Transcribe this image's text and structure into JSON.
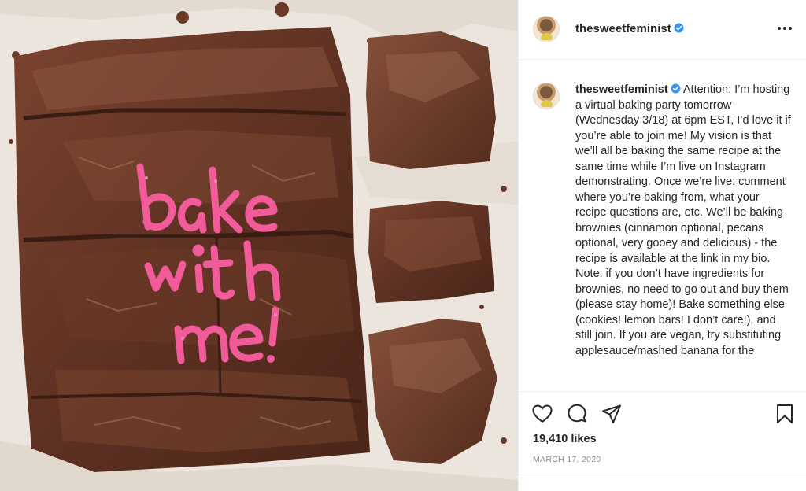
{
  "post": {
    "image_alt_text": "bake with me!",
    "username": "thesweetfeminist",
    "verified": true,
    "caption": "Attention: I’m hosting a virtual baking party tomorrow (Wednesday 3/18) at 6pm EST, I’d love it if you’re able to join me! My vision is that we’ll all be baking the same recipe at the same time while I’m live on Instagram demonstrating. Once we’re live: comment where you’re baking from, what your recipe questions are, etc. We’ll be baking brownies (cinnamon optional, pecans optional, very gooey and delicious) - the recipe is available at the link in my bio. Note: if you don’t have ingredients for brownies, no need to go out and buy them (please stay home)! Bake something else (cookies! lemon bars! I don’t care!), and still join. If you are vegan, try substituting applesauce/mashed banana for the",
    "likes": "19,410 likes",
    "date": "MARCH 17, 2020"
  },
  "icons": {
    "verified": "verified-badge-icon",
    "more": "more-options-icon",
    "like": "heart-icon",
    "comment": "comment-icon",
    "share": "send-icon",
    "save": "bookmark-icon"
  },
  "colors": {
    "verified_blue": "#3897f0",
    "icing_pink": "#f25b9a",
    "brownie": "#5a3020"
  }
}
